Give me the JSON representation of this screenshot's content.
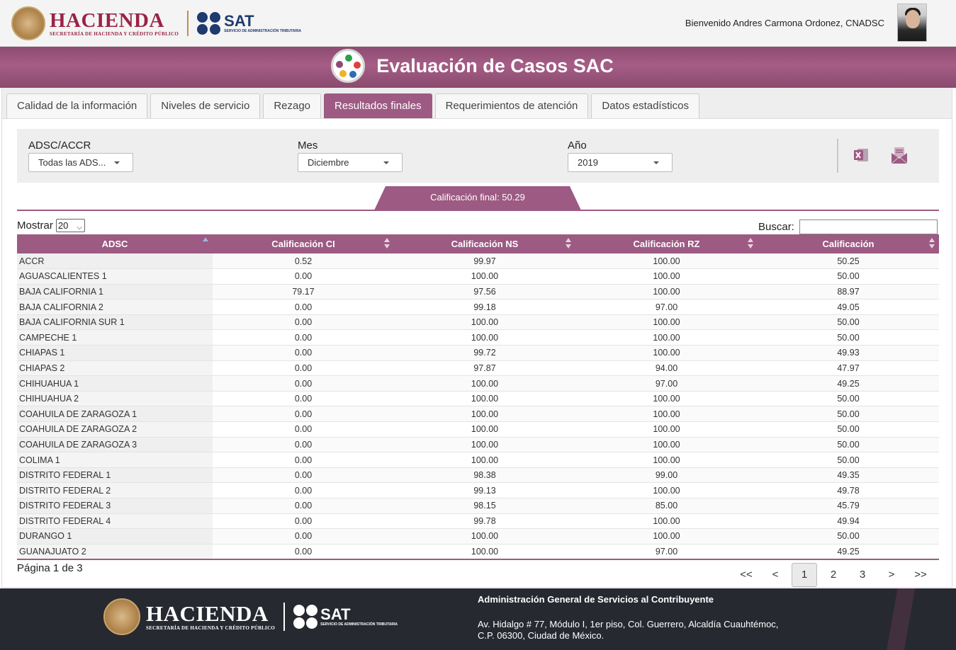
{
  "header": {
    "brand_hacienda": "HACIENDA",
    "brand_hacienda_sub": "SECRETARÍA DE HACIENDA Y CRÉDITO PÚBLICO",
    "brand_sat": "SAT",
    "brand_sat_sub": "SERVICIO DE ADMINISTRACIÓN TRIBUTARIA",
    "welcome": "Bienvenido Andres Carmona Ordonez, CNADSC"
  },
  "title": "Evaluación de Casos SAC",
  "tabs": [
    {
      "label": "Calidad de la información"
    },
    {
      "label": "Niveles de servicio"
    },
    {
      "label": "Rezago"
    },
    {
      "label": "Resultados finales"
    },
    {
      "label": "Requerimientos de atención"
    },
    {
      "label": "Datos estadísticos"
    }
  ],
  "active_tab": "Resultados finales",
  "filters": {
    "adsc_label": "ADSC/ACCR",
    "adsc_value": "Todas las ADS...",
    "mes_label": "Mes",
    "mes_value": "Diciembre",
    "anio_label": "Año",
    "anio_value": "2019"
  },
  "calificacion_final": "Calificación final: 50.29",
  "table_controls": {
    "mostrar_label": "Mostrar",
    "mostrar_value": "20",
    "buscar_label": "Buscar:",
    "buscar_value": ""
  },
  "table": {
    "columns": [
      "ADSC",
      "Calificación CI",
      "Calificación NS",
      "Calificación RZ",
      "Calificación"
    ],
    "rows": [
      [
        "ACCR",
        "0.52",
        "99.97",
        "100.00",
        "50.25"
      ],
      [
        "AGUASCALIENTES 1",
        "0.00",
        "100.00",
        "100.00",
        "50.00"
      ],
      [
        "BAJA CALIFORNIA 1",
        "79.17",
        "97.56",
        "100.00",
        "88.97"
      ],
      [
        "BAJA CALIFORNIA 2",
        "0.00",
        "99.18",
        "97.00",
        "49.05"
      ],
      [
        "BAJA CALIFORNIA SUR 1",
        "0.00",
        "100.00",
        "100.00",
        "50.00"
      ],
      [
        "CAMPECHE 1",
        "0.00",
        "100.00",
        "100.00",
        "50.00"
      ],
      [
        "CHIAPAS 1",
        "0.00",
        "99.72",
        "100.00",
        "49.93"
      ],
      [
        "CHIAPAS 2",
        "0.00",
        "97.87",
        "94.00",
        "47.97"
      ],
      [
        "CHIHUAHUA 1",
        "0.00",
        "100.00",
        "97.00",
        "49.25"
      ],
      [
        "CHIHUAHUA 2",
        "0.00",
        "100.00",
        "100.00",
        "50.00"
      ],
      [
        "COAHUILA DE ZARAGOZA 1",
        "0.00",
        "100.00",
        "100.00",
        "50.00"
      ],
      [
        "COAHUILA DE ZARAGOZA 2",
        "0.00",
        "100.00",
        "100.00",
        "50.00"
      ],
      [
        "COAHUILA DE ZARAGOZA 3",
        "0.00",
        "100.00",
        "100.00",
        "50.00"
      ],
      [
        "COLIMA 1",
        "0.00",
        "100.00",
        "100.00",
        "50.00"
      ],
      [
        "DISTRITO FEDERAL 1",
        "0.00",
        "98.38",
        "99.00",
        "49.35"
      ],
      [
        "DISTRITO FEDERAL 2",
        "0.00",
        "99.13",
        "100.00",
        "49.78"
      ],
      [
        "DISTRITO FEDERAL 3",
        "0.00",
        "98.15",
        "85.00",
        "45.79"
      ],
      [
        "DISTRITO FEDERAL 4",
        "0.00",
        "99.78",
        "100.00",
        "49.94"
      ],
      [
        "DURANGO 1",
        "0.00",
        "100.00",
        "100.00",
        "50.00"
      ],
      [
        "GUANAJUATO 2",
        "0.00",
        "100.00",
        "97.00",
        "49.25"
      ]
    ]
  },
  "pagination": {
    "info": "Página 1 de 3",
    "first": "<<",
    "prev": "<",
    "pages": [
      "1",
      "2",
      "3"
    ],
    "current": "1",
    "next": ">",
    "last": ">>"
  },
  "footer": {
    "title": "Administración General de Servicios al Contribuyente",
    "address_line1": "Av. Hidalgo # 77, Módulo I, 1er piso, Col. Guerrero, Alcaldía Cuauhtémoc,",
    "address_line2": "C.P. 06300, Ciudad de México."
  },
  "colors": {
    "brand": "#9d5a83",
    "hacienda": "#9b2247",
    "sat": "#1e3a6e",
    "footer_bg": "#262930"
  }
}
